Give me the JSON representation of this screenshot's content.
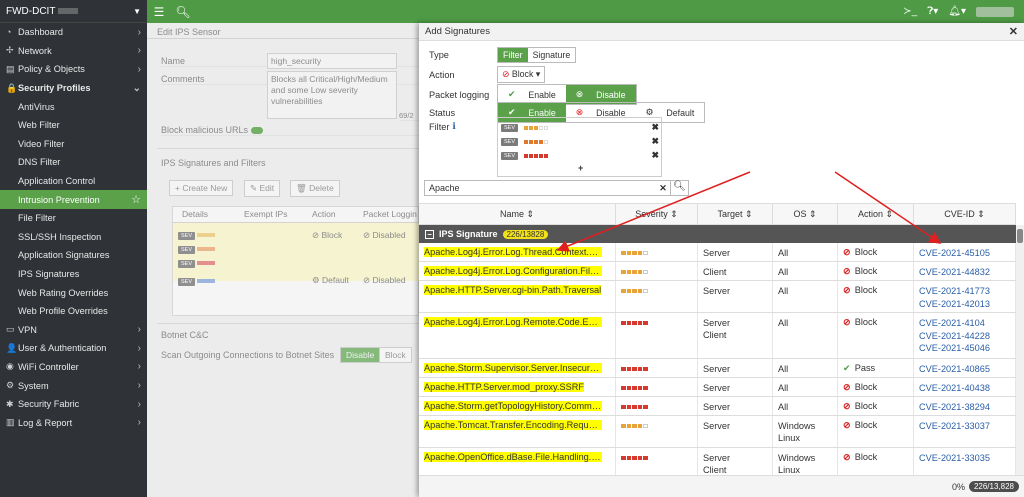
{
  "device": {
    "name": "FWD-DCIT"
  },
  "sidebar": {
    "items": [
      {
        "label": "Dashboard",
        "icon": "dashboard-icon",
        "glyph": "◔"
      },
      {
        "label": "Network",
        "icon": "network-icon",
        "glyph": "✢"
      },
      {
        "label": "Policy & Objects",
        "icon": "policy-icon",
        "glyph": "▤"
      },
      {
        "label": "Security Profiles",
        "icon": "lock-icon",
        "glyph": "🔒"
      },
      {
        "label": "AntiVirus"
      },
      {
        "label": "Web Filter"
      },
      {
        "label": "Video Filter"
      },
      {
        "label": "DNS Filter"
      },
      {
        "label": "Application Control"
      },
      {
        "label": "Intrusion Prevention"
      },
      {
        "label": "File Filter"
      },
      {
        "label": "SSL/SSH Inspection"
      },
      {
        "label": "Application Signatures"
      },
      {
        "label": "IPS Signatures"
      },
      {
        "label": "Web Rating Overrides"
      },
      {
        "label": "Web Profile Overrides"
      },
      {
        "label": "VPN",
        "icon": "vpn-icon",
        "glyph": "▭"
      },
      {
        "label": "User & Authentication",
        "icon": "user-icon",
        "glyph": "👤"
      },
      {
        "label": "WiFi Controller",
        "icon": "wifi-icon",
        "glyph": "◉"
      },
      {
        "label": "System",
        "icon": "gear-icon",
        "glyph": "⚙"
      },
      {
        "label": "Security Fabric",
        "icon": "fabric-icon",
        "glyph": "✱"
      },
      {
        "label": "Log & Report",
        "icon": "chart-icon",
        "glyph": "▥"
      }
    ]
  },
  "background": {
    "title": "Edit IPS Sensor",
    "name_label": "Name",
    "name_value": "high_security",
    "comments_label": "Comments",
    "comments_value": "Blocks all Critical/High/Medium and some Low severity vulnerabilities",
    "comments_count": "69/2",
    "block_malicious": "Block malicious URLs",
    "section": "IPS Signatures and Filters",
    "create_new": "+ Create New",
    "edit": "✎ Edit",
    "delete": "🗑 Delete",
    "headers": [
      "Details",
      "Exempt IPs",
      "Action",
      "Packet Loggin"
    ],
    "row1_action": "Block",
    "row1_log": "Disabled",
    "row2_action": "Default",
    "row2_log": "Disabled",
    "botnet": "Botnet C&C",
    "botnet_label": "Scan Outgoing Connections to Botnet Sites",
    "botnet_disable": "Disable",
    "botnet_block": "Block",
    "sev": "SEV"
  },
  "modal": {
    "title": "Add Signatures",
    "type_label": "Type",
    "type_filter": "Filter",
    "type_signature": "Signature",
    "action_label": "Action",
    "action_value": "Block",
    "plog_label": "Packet logging",
    "plog_enable": "Enable",
    "plog_disable": "Disable",
    "status_label": "Status",
    "status_enable": "Enable",
    "status_disable": "Disable",
    "status_default": "Default",
    "filter_label": "Filter",
    "sev": "SEV",
    "search_value": "Apache",
    "columns": [
      "Name",
      "Severity",
      "Target",
      "OS",
      "Action",
      "CVE-ID"
    ],
    "group_label": "IPS Signature",
    "group_count": "226/13828",
    "footer_pct": "0%",
    "footer_count": "226/13,828"
  },
  "rows": [
    {
      "name": "Apache.Log4j.Error.Log.Thread.Context.DoS",
      "sev": 3,
      "target": [
        "Server"
      ],
      "os": [
        "All"
      ],
      "action": "Block",
      "cve": [
        "CVE-2021-45105"
      ]
    },
    {
      "name": "Apache.Log4j.Error.Log.Configuration.File.Re...",
      "sev": 3,
      "target": [
        "Client"
      ],
      "os": [
        "All"
      ],
      "action": "Block",
      "cve": [
        "CVE-2021-44832"
      ]
    },
    {
      "name": "Apache.HTTP.Server.cgi-bin.Path.Traversal",
      "sev": 3,
      "target": [
        "Server"
      ],
      "os": [
        "All"
      ],
      "action": "Block",
      "cve": [
        "CVE-2021-41773",
        "CVE-2021-42013"
      ]
    },
    {
      "name": "Apache.Log4j.Error.Log.Remote.Code.Executi...",
      "sev": 5,
      "target": [
        "Server",
        "Client"
      ],
      "os": [
        "All"
      ],
      "action": "Block",
      "cve": [
        "CVE-2021-4104",
        "CVE-2021-44228",
        "CVE-2021-45046"
      ]
    },
    {
      "name": "Apache.Storm.Supervisor.Server.Insecure.De...",
      "sev": 5,
      "target": [
        "Server"
      ],
      "os": [
        "All"
      ],
      "action": "Pass",
      "cve": [
        "CVE-2021-40865"
      ]
    },
    {
      "name": "Apache.HTTP.Server.mod_proxy.SSRF",
      "sev": 5,
      "target": [
        "Server"
      ],
      "os": [
        "All"
      ],
      "action": "Block",
      "cve": [
        "CVE-2021-40438"
      ]
    },
    {
      "name": "Apache.Storm.getTopologyHistory.Command....",
      "sev": 5,
      "target": [
        "Server"
      ],
      "os": [
        "All"
      ],
      "action": "Block",
      "cve": [
        "CVE-2021-38294"
      ]
    },
    {
      "name": "Apache.Tomcat.Transfer.Encoding.Request.S...",
      "sev": 3,
      "target": [
        "Server"
      ],
      "os": [
        "Windows",
        "Linux"
      ],
      "action": "Block",
      "cve": [
        "CVE-2021-33037"
      ]
    },
    {
      "name": "Apache.OpenOffice.dBase.File.Handling.Buff...",
      "sev": 5,
      "target": [
        "Server",
        "Client"
      ],
      "os": [
        "Windows",
        "Linux"
      ],
      "action": "Block",
      "cve": [
        "CVE-2021-33035"
      ]
    }
  ],
  "colors": {
    "accent": "#4e9a45",
    "high": "#e8a33a",
    "critical": "#d63a2f",
    "highlight": "#ffff00",
    "arrow": "#e02020"
  }
}
